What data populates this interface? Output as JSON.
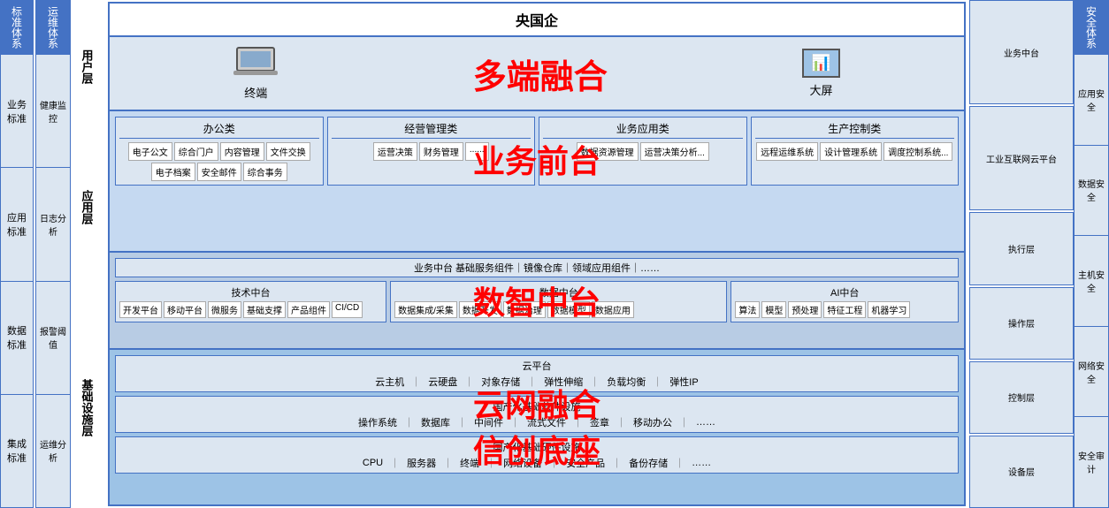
{
  "topBar": {
    "title": "央国企"
  },
  "leftSidebar": {
    "biaozhun": {
      "header": "标准体系",
      "items": [
        "业务标准",
        "应用标准",
        "数据标准",
        "集成标准"
      ]
    },
    "yunwei": {
      "header": "运维体系",
      "items": [
        "健康监控",
        "日志分析",
        "报警阈值",
        "运维分析"
      ]
    },
    "layerLabels": [
      "用户层",
      "应用层",
      "基础设施层"
    ]
  },
  "userLayer": {
    "terminal": "终端",
    "centerLabel": "多端融合",
    "screen": "大屏"
  },
  "appLayer": {
    "categories": [
      {
        "title": "办公类",
        "items": [
          "电子公文",
          "综合门户",
          "内容管理",
          "文件交换",
          "电子档案",
          "安全邮件",
          "综合事务"
        ]
      },
      {
        "title": "经营管理类",
        "items": [
          "运营决策",
          "财务管理",
          "......"
        ]
      },
      {
        "title": "业务应用类",
        "items": [
          "数据资源管理",
          "运营决策分析..."
        ]
      },
      {
        "title": "生产控制类",
        "items": [
          "远程运维系统",
          "设计管理系统",
          "调度控制系统..."
        ]
      }
    ],
    "centerLabel": "业务前台"
  },
  "platformLayer": {
    "topBar": "业务中台   基础服务组件｜镜像仓库｜领域应用组件｜……",
    "centerLabel": "数智中台",
    "tech": {
      "title": "技术中台",
      "items": [
        "开发平台",
        "移动平台",
        "微服务",
        "基础支撑",
        "产品组件",
        "CI/CD"
      ]
    },
    "data": {
      "title": "数据中台",
      "items": [
        "数据集成/采集",
        "数据开发",
        "数据治理",
        "数据模型",
        "数据应用"
      ]
    },
    "ai": {
      "title": "AI中台",
      "items": [
        "算法",
        "模型",
        "预处理",
        "特征工程",
        "机器学习"
      ]
    }
  },
  "infraLayer": {
    "centerLabel": "云网融合",
    "secondLabel": "信创底座",
    "cloud": {
      "title": "云平台",
      "items": [
        "云主机",
        "云硬盘",
        "对象存储",
        "弹性伸缩",
        "负载均衡",
        "弹性IP"
      ]
    },
    "software": {
      "title": "国产化基础软件设施",
      "items": [
        "操作系统",
        "数据库",
        "中间件",
        "流式文件",
        "签章",
        "移动办公",
        "……"
      ]
    },
    "hardware": {
      "title": "国产化基础硬件设施",
      "items": [
        "CPU",
        "服务器",
        "终端",
        "网络设备",
        "安全产品",
        "备份存储",
        "……"
      ]
    }
  },
  "rightSidebar": {
    "anquan": {
      "header": "安全体系",
      "items": [
        "应用安全",
        "数据安全",
        "主机安全",
        "网络安全",
        "安全审计"
      ]
    },
    "industrial": {
      "blocks": [
        "业务中台",
        "工业互联网云平台",
        "执行层",
        "操作层",
        "控制层",
        "设备层"
      ]
    }
  }
}
